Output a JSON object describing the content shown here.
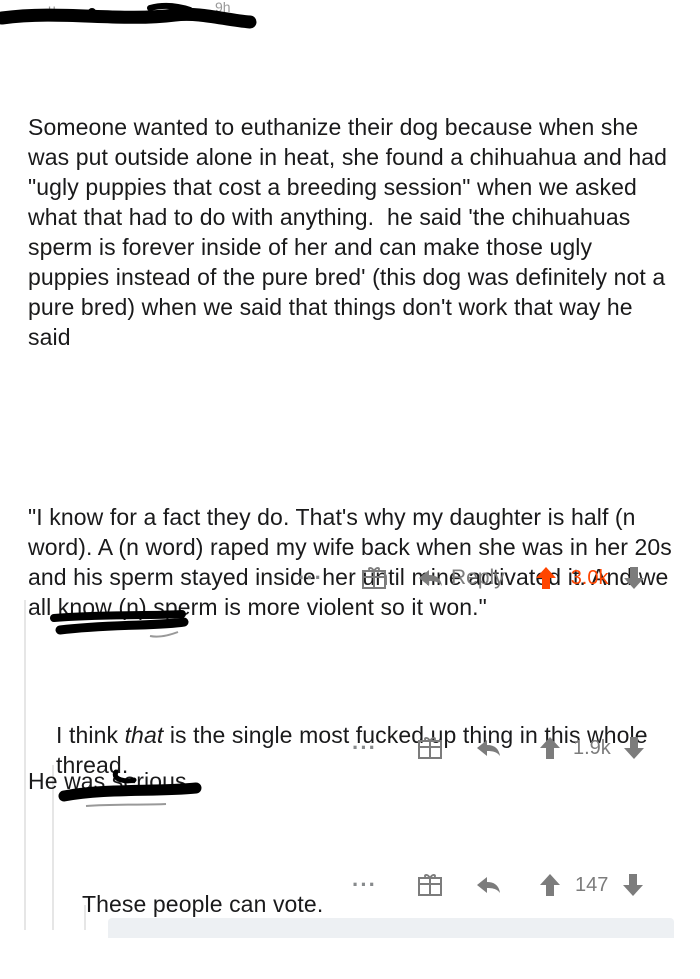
{
  "comments": [
    {
      "username_hidden": true,
      "time": "9h",
      "paragraphs": [
        "Someone wanted to euthanize their dog because when she was put outside alone in heat, she found a chihuahua and had \"ugly puppies that cost a breeding session\" when we asked what that had to do with anything.  he said 'the chihuahuas sperm is forever inside of her and can make those ugly puppies instead of the pure bred' (this dog was definitely not a pure bred) when we said that things don't work that way he said",
        "\"I know for a fact they do. That's why my daughter is half (n word). A (n word) raped my wife back when she was in her 20s and his sperm stayed inside her until mine activated it. And we all know (n) sperm is more violent so it won.\"",
        "He was serious"
      ],
      "reply_label": "Reply",
      "score": "3.0k",
      "upvoted": true
    },
    {
      "username_hidden": true,
      "text_before": "I think ",
      "text_em": "that",
      "text_after": " is the single most fucked up thing in this whole thread.",
      "score": "1.9k",
      "upvoted": false
    },
    {
      "username_hidden": true,
      "text": "These people can vote.",
      "score": "147",
      "upvoted": false
    }
  ],
  "icons": {
    "more": "more-dots-icon",
    "award": "gift-icon",
    "reply": "reply-arrow-icon",
    "upvote": "upvote-arrow-icon",
    "downvote": "downvote-arrow-icon"
  },
  "colors": {
    "upvote_active": "#ff4500",
    "muted": "#7c7c7c",
    "text": "#1a1a1b",
    "thread_line": "#e6e6e6"
  }
}
